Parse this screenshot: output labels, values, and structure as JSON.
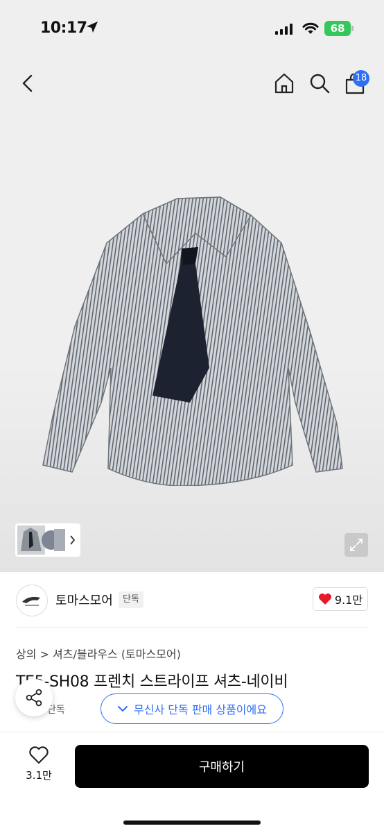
{
  "status_bar": {
    "time": "10:17",
    "battery": "68"
  },
  "header": {
    "cart_count": "18"
  },
  "brand": {
    "name": "토마스모어",
    "tag": "단독",
    "likes": "9.1만"
  },
  "breadcrumb": "상의 > 셔츠/블라우스 (토마스모어)",
  "product": {
    "title": "TE5-SH08 프렌치 스트라이프 셔츠-네이비",
    "exclusive_tag": "단독",
    "exclusive_pill": "무신사 단독 판매 상품이에요"
  },
  "bottom_bar": {
    "like_count": "3.1만",
    "buy_label": "구매하기"
  },
  "colors": {
    "accent": "#2f6ef5",
    "heart": "#e8182c",
    "buy": "#000000"
  }
}
